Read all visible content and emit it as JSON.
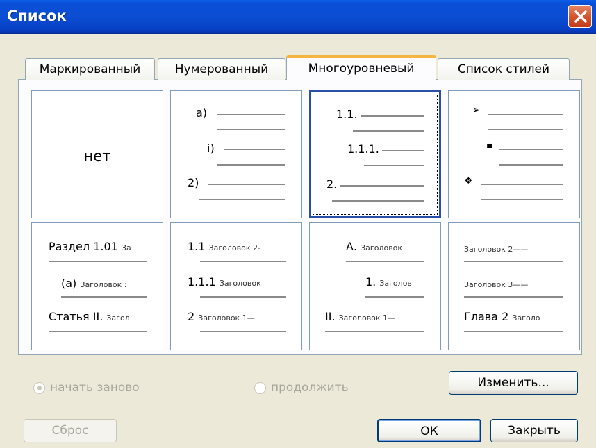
{
  "dialog": {
    "title": "Список",
    "close_icon": "close-icon"
  },
  "tabs": [
    {
      "label": "Маркированный",
      "active": false
    },
    {
      "label": "Нумерованный",
      "active": false
    },
    {
      "label": "Многоуровневый",
      "active": true
    },
    {
      "label": "Список стилей",
      "active": false
    }
  ],
  "gallery": {
    "none_label": "нет",
    "c2": {
      "a": "а)",
      "b": "i)",
      "c": "2)"
    },
    "c3": {
      "a": "1.1.",
      "b": "1.1.1.",
      "c": "2."
    },
    "c4": {
      "a": "➢",
      "b": "▪",
      "c": "❖"
    },
    "c5": {
      "a_num": "Раздел 1.01",
      "a_sub": "За",
      "b_num": "(а)",
      "b_sub": "Заголовок :",
      "c_num": "Статья II.",
      "c_sub": "Загол"
    },
    "c6": {
      "a_num": "1.1",
      "a_sub": "Заголовок 2-",
      "b_num": "1.1.1",
      "b_sub": "Заголовок",
      "c_num": "2",
      "c_sub": "Заголовок 1—"
    },
    "c7": {
      "a_num": "А.",
      "a_sub": "Заголовок",
      "b_num": "1.",
      "b_sub": "Заголов",
      "c_num": "II.",
      "c_sub": "Заголовок 1—"
    },
    "c8": {
      "a_sub": "Заголовок 2——",
      "b_sub": "Заголовок 3——",
      "c_num": "Глава 2",
      "c_sub": "Заголо"
    }
  },
  "options": {
    "restart": "начать заново",
    "continue": "продолжить"
  },
  "buttons": {
    "modify": "Изменить...",
    "reset": "Сброс",
    "ok": "ОК",
    "close": "Закрыть"
  }
}
